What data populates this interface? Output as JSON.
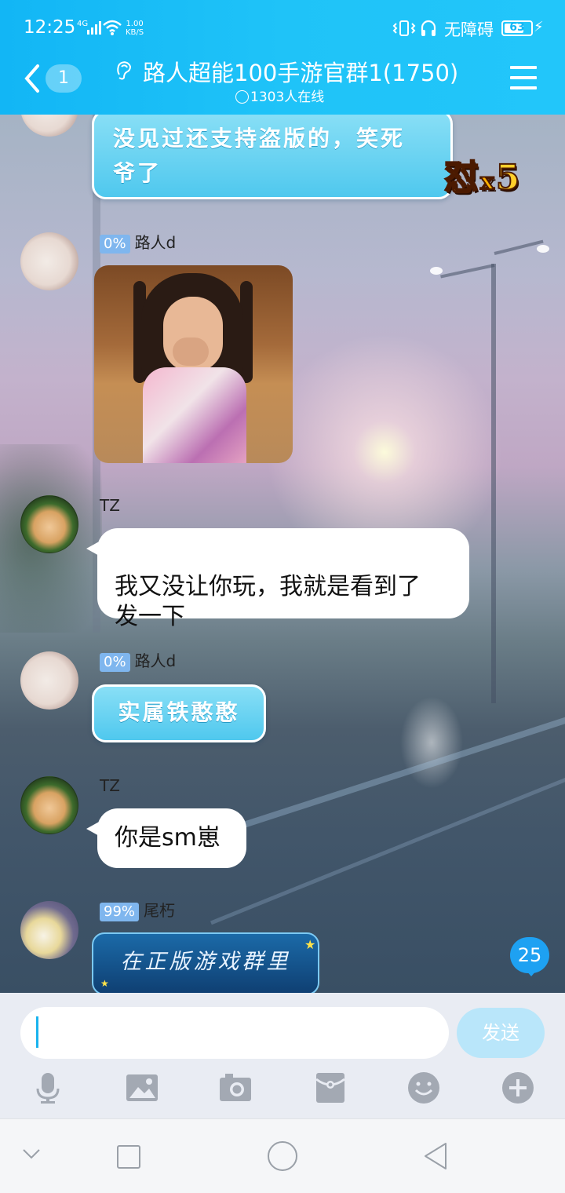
{
  "status_bar": {
    "time": "12:25",
    "network": "4G",
    "speed_value": "1.00",
    "speed_unit": "KB/S",
    "accessibility": "无障碍",
    "battery": "63"
  },
  "header": {
    "unread_badge": "1",
    "title": "路人超能100手游官群1(1750)",
    "online": "1303人在线"
  },
  "combo": {
    "label": "怼",
    "mult": "x",
    "count": "5"
  },
  "messages": [
    {
      "text": "没见过还支持盗版的，笑死\n爷了"
    },
    {
      "level": "0%",
      "sender": "路人d",
      "type": "image"
    },
    {
      "sender": "TZ",
      "text": "我又没让你玩，我就是看到了\n发一下"
    },
    {
      "level": "0%",
      "sender": "路人d",
      "text": "实属铁憨憨"
    },
    {
      "sender": "TZ",
      "text": "你是sm崽"
    },
    {
      "level": "99%",
      "sender": "尾朽",
      "text": "在正版游戏群里"
    }
  ],
  "new_messages_count": "25",
  "input": {
    "value": "",
    "placeholder": ""
  },
  "send_label": "发送",
  "toolbar_icons": [
    "microphone-icon",
    "image-icon",
    "camera-icon",
    "red-packet-icon",
    "emoji-icon",
    "plus-icon"
  ],
  "colors": {
    "header": "#1fc3f8",
    "send_disabled": "#b9e6fa",
    "level_badge": "#7fb6ee"
  }
}
